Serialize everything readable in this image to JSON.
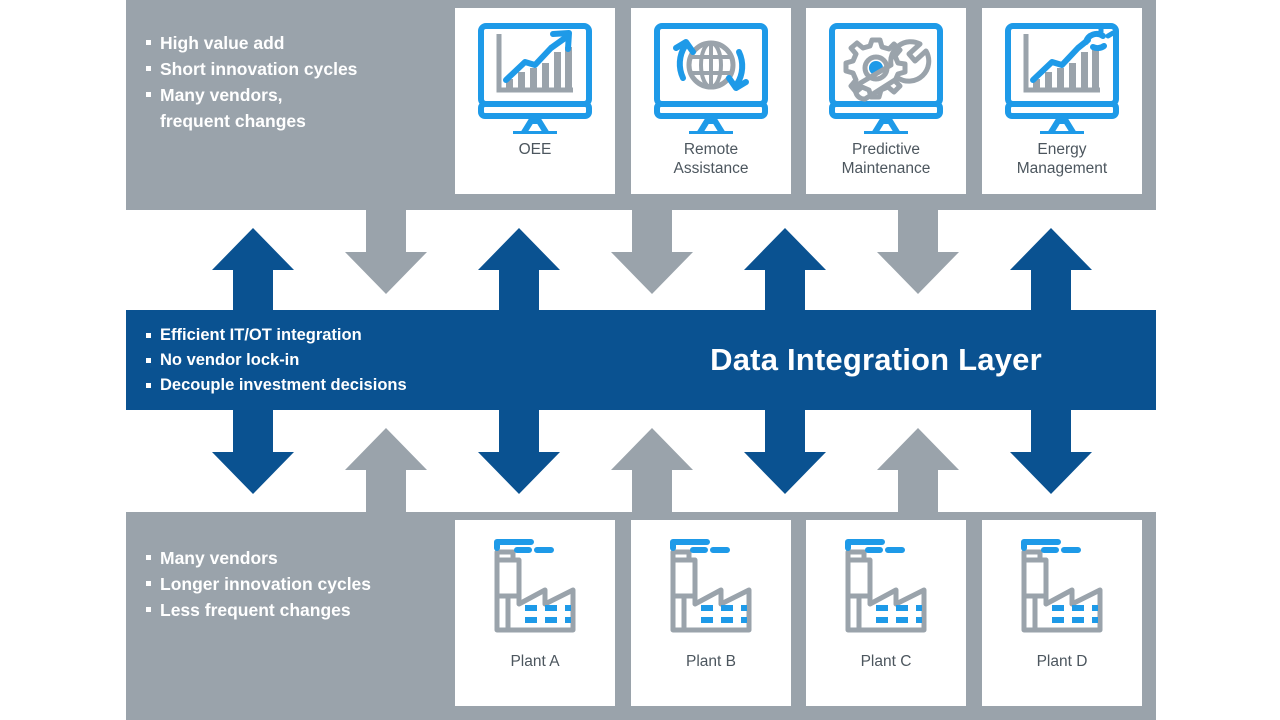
{
  "colors": {
    "panel_gray": "#9aa3ab",
    "band_blue": "#0A5291",
    "accent_blue": "#1E9AE8",
    "icon_gray": "#9aa3ab",
    "arrow_blue": "#0A5291",
    "arrow_gray": "#9aa3ab",
    "card_bg": "#ffffff",
    "label_text": "#4c565e"
  },
  "top_section": {
    "bullets": [
      "High value add",
      "Short innovation cycles",
      "Many vendors,\nfrequent changes"
    ],
    "cards": [
      {
        "label": "OEE",
        "icon": "monitor-bar-chart-trend-icon"
      },
      {
        "label": "Remote\nAssistance",
        "icon": "monitor-globe-refresh-icon"
      },
      {
        "label": "Predictive\nMaintenance",
        "icon": "monitor-gear-wrench-icon"
      },
      {
        "label": "Energy\nManagement",
        "icon": "monitor-bar-chart-plug-icon"
      }
    ]
  },
  "band": {
    "title": "Data Integration Layer",
    "bullets": [
      "Efficient IT/OT integration",
      "No vendor lock-in",
      "Decouple investment decisions"
    ]
  },
  "bottom_section": {
    "bullets": [
      "Many vendors",
      "Longer innovation cycles",
      "Less frequent changes"
    ],
    "cards": [
      {
        "label": "Plant A",
        "icon": "factory-icon"
      },
      {
        "label": "Plant B",
        "icon": "factory-icon"
      },
      {
        "label": "Plant C",
        "icon": "factory-icon"
      },
      {
        "label": "Plant D",
        "icon": "factory-icon"
      }
    ]
  },
  "arrows": {
    "upper_row": [
      {
        "direction": "up",
        "color": "blue"
      },
      {
        "direction": "down",
        "color": "gray"
      },
      {
        "direction": "up",
        "color": "blue"
      },
      {
        "direction": "down",
        "color": "gray"
      },
      {
        "direction": "up",
        "color": "blue"
      },
      {
        "direction": "down",
        "color": "gray"
      },
      {
        "direction": "up",
        "color": "blue"
      }
    ],
    "lower_row": [
      {
        "direction": "down",
        "color": "blue"
      },
      {
        "direction": "up",
        "color": "gray"
      },
      {
        "direction": "down",
        "color": "blue"
      },
      {
        "direction": "up",
        "color": "gray"
      },
      {
        "direction": "down",
        "color": "blue"
      },
      {
        "direction": "up",
        "color": "gray"
      },
      {
        "direction": "down",
        "color": "blue"
      }
    ]
  }
}
